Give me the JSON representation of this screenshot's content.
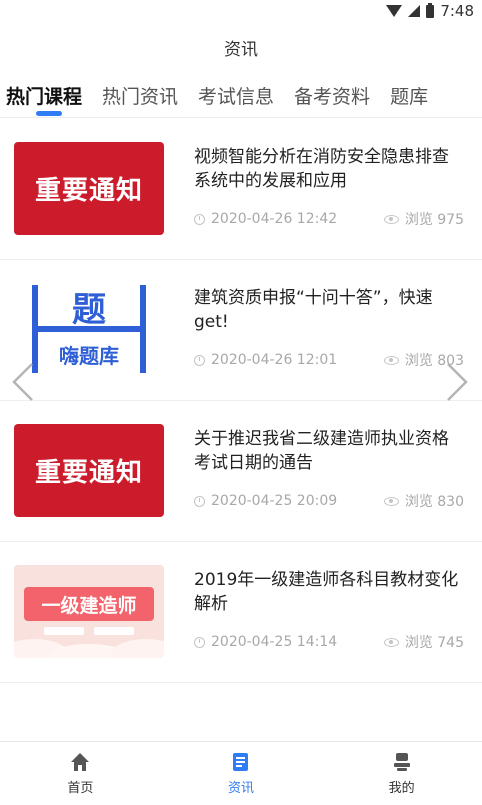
{
  "status_bar": {
    "time": "7:48",
    "icons": [
      "wifi-icon",
      "signal-icon",
      "battery-icon"
    ]
  },
  "header": {
    "title": "资讯"
  },
  "tabs": [
    {
      "label": "热门课程",
      "active": true
    },
    {
      "label": "热门资讯",
      "active": false
    },
    {
      "label": "考试信息",
      "active": false
    },
    {
      "label": "备考资料",
      "active": false
    },
    {
      "label": "题库",
      "active": false
    }
  ],
  "articles": [
    {
      "title": "视频智能分析在消防安全隐患排查系统中的发展和应用",
      "date": "2020-04-26 12:42",
      "views": "浏览 975",
      "thumb_text": "重要通知"
    },
    {
      "title": "建筑资质申报“十问十答”，快速get!",
      "date": "2020-04-26 12:01",
      "views": "浏览 803",
      "thumb_text_top": "题",
      "thumb_text_bottom": "嗨题库"
    },
    {
      "title": "关于推迟我省二级建造师执业资格考试日期的通告",
      "date": "2020-04-25 20:09",
      "views": "浏览 830",
      "thumb_text": "重要通知"
    },
    {
      "title": "2019年一级建造师各科目教材变化解析",
      "date": "2020-04-25 14:14",
      "views": "浏览 745",
      "thumb_text": "一级建造师"
    }
  ],
  "bottom_nav": [
    {
      "label": "首页",
      "icon": "home-icon",
      "active": false
    },
    {
      "label": "资讯",
      "icon": "news-icon",
      "active": true
    },
    {
      "label": "我的",
      "icon": "profile-icon",
      "active": false
    }
  ],
  "colors": {
    "accent": "#2f7df6",
    "notice_red": "#cc1b2a",
    "meta_gray": "#a8a8a8"
  }
}
